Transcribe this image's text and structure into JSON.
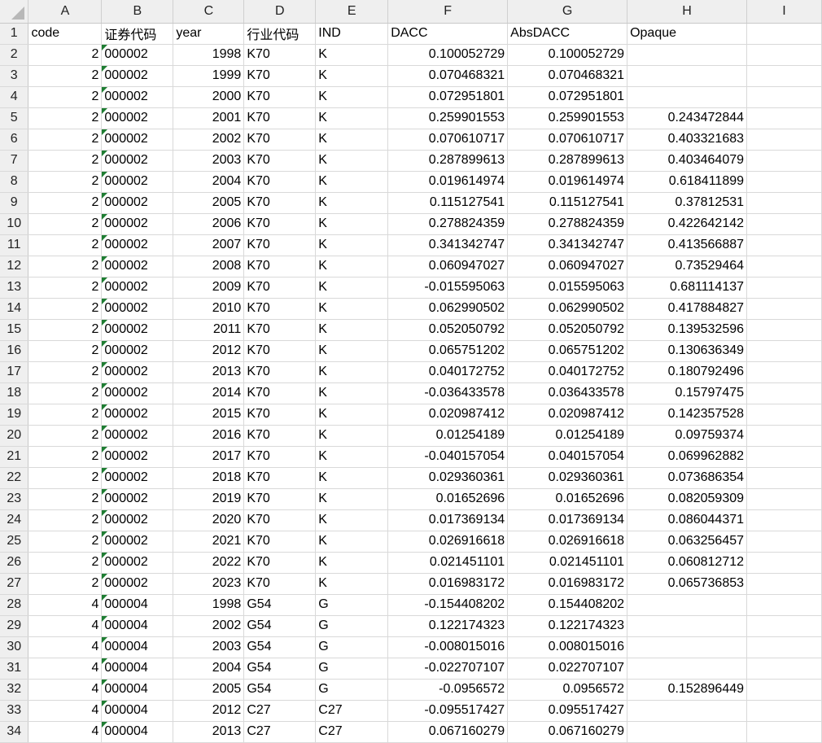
{
  "columns": [
    "A",
    "B",
    "C",
    "D",
    "E",
    "F",
    "G",
    "H",
    "I"
  ],
  "colors": {
    "text_flag": "#1e7d32",
    "grid": "#d9d9d9",
    "header_bg": "#efefef"
  },
  "header_row": [
    "code",
    "证券代码",
    "year",
    "行业代码",
    "IND",
    "DACC",
    "AbsDACC",
    "Opaque",
    ""
  ],
  "rows": [
    [
      "2",
      "000002",
      "1998",
      "K70",
      "K",
      "0.100052729",
      "0.100052729",
      ""
    ],
    [
      "2",
      "000002",
      "1999",
      "K70",
      "K",
      "0.070468321",
      "0.070468321",
      ""
    ],
    [
      "2",
      "000002",
      "2000",
      "K70",
      "K",
      "0.072951801",
      "0.072951801",
      ""
    ],
    [
      "2",
      "000002",
      "2001",
      "K70",
      "K",
      "0.259901553",
      "0.259901553",
      "0.243472844"
    ],
    [
      "2",
      "000002",
      "2002",
      "K70",
      "K",
      "0.070610717",
      "0.070610717",
      "0.403321683"
    ],
    [
      "2",
      "000002",
      "2003",
      "K70",
      "K",
      "0.287899613",
      "0.287899613",
      "0.403464079"
    ],
    [
      "2",
      "000002",
      "2004",
      "K70",
      "K",
      "0.019614974",
      "0.019614974",
      "0.618411899"
    ],
    [
      "2",
      "000002",
      "2005",
      "K70",
      "K",
      "0.115127541",
      "0.115127541",
      "0.37812531"
    ],
    [
      "2",
      "000002",
      "2006",
      "K70",
      "K",
      "0.278824359",
      "0.278824359",
      "0.422642142"
    ],
    [
      "2",
      "000002",
      "2007",
      "K70",
      "K",
      "0.341342747",
      "0.341342747",
      "0.413566887"
    ],
    [
      "2",
      "000002",
      "2008",
      "K70",
      "K",
      "0.060947027",
      "0.060947027",
      "0.73529464"
    ],
    [
      "2",
      "000002",
      "2009",
      "K70",
      "K",
      "-0.015595063",
      "0.015595063",
      "0.681114137"
    ],
    [
      "2",
      "000002",
      "2010",
      "K70",
      "K",
      "0.062990502",
      "0.062990502",
      "0.417884827"
    ],
    [
      "2",
      "000002",
      "2011",
      "K70",
      "K",
      "0.052050792",
      "0.052050792",
      "0.139532596"
    ],
    [
      "2",
      "000002",
      "2012",
      "K70",
      "K",
      "0.065751202",
      "0.065751202",
      "0.130636349"
    ],
    [
      "2",
      "000002",
      "2013",
      "K70",
      "K",
      "0.040172752",
      "0.040172752",
      "0.180792496"
    ],
    [
      "2",
      "000002",
      "2014",
      "K70",
      "K",
      "-0.036433578",
      "0.036433578",
      "0.15797475"
    ],
    [
      "2",
      "000002",
      "2015",
      "K70",
      "K",
      "0.020987412",
      "0.020987412",
      "0.142357528"
    ],
    [
      "2",
      "000002",
      "2016",
      "K70",
      "K",
      "0.01254189",
      "0.01254189",
      "0.09759374"
    ],
    [
      "2",
      "000002",
      "2017",
      "K70",
      "K",
      "-0.040157054",
      "0.040157054",
      "0.069962882"
    ],
    [
      "2",
      "000002",
      "2018",
      "K70",
      "K",
      "0.029360361",
      "0.029360361",
      "0.073686354"
    ],
    [
      "2",
      "000002",
      "2019",
      "K70",
      "K",
      "0.01652696",
      "0.01652696",
      "0.082059309"
    ],
    [
      "2",
      "000002",
      "2020",
      "K70",
      "K",
      "0.017369134",
      "0.017369134",
      "0.086044371"
    ],
    [
      "2",
      "000002",
      "2021",
      "K70",
      "K",
      "0.026916618",
      "0.026916618",
      "0.063256457"
    ],
    [
      "2",
      "000002",
      "2022",
      "K70",
      "K",
      "0.021451101",
      "0.021451101",
      "0.060812712"
    ],
    [
      "2",
      "000002",
      "2023",
      "K70",
      "K",
      "0.016983172",
      "0.016983172",
      "0.065736853"
    ],
    [
      "4",
      "000004",
      "1998",
      "G54",
      "G",
      "-0.154408202",
      "0.154408202",
      ""
    ],
    [
      "4",
      "000004",
      "2002",
      "G54",
      "G",
      "0.122174323",
      "0.122174323",
      ""
    ],
    [
      "4",
      "000004",
      "2003",
      "G54",
      "G",
      "-0.008015016",
      "0.008015016",
      ""
    ],
    [
      "4",
      "000004",
      "2004",
      "G54",
      "G",
      "-0.022707107",
      "0.022707107",
      ""
    ],
    [
      "4",
      "000004",
      "2005",
      "G54",
      "G",
      "-0.0956572",
      "0.0956572",
      "0.152896449"
    ],
    [
      "4",
      "000004",
      "2012",
      "C27",
      "C27",
      "-0.095517427",
      "0.095517427",
      ""
    ],
    [
      "4",
      "000004",
      "2013",
      "C27",
      "C27",
      "0.067160279",
      "0.067160279",
      ""
    ]
  ]
}
